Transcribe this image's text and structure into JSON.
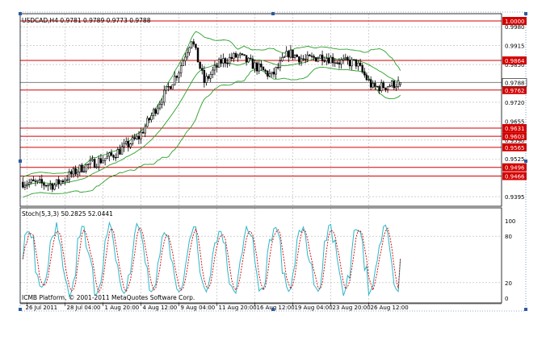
{
  "header": {
    "title": "USDCAD,H4 0.9781 0.9789 0.9773 0.9788"
  },
  "indicator": {
    "title": "Stoch(5,3,3) 50.2825 52.0441",
    "levels": [
      100,
      80,
      20,
      0
    ],
    "level_labels": [
      "100",
      "80",
      "20",
      "0"
    ]
  },
  "footer": {
    "copyright": "ICMB Platform, © 2001-2011 MetaQuotes Software Corp."
  },
  "colors": {
    "candle": "#000000",
    "bands": "#2aa02a",
    "resistance_lines": "#d40000",
    "current_price_line": "#808080",
    "stoch_main": "#2ab8c8",
    "stoch_signal": "#d40000",
    "grid": "#b4b4b4",
    "selection_handle": "#2d5aa0"
  },
  "chart_data": [
    {
      "type": "candlestick",
      "title": "USDCAD,H4 0.9781 0.9789 0.9773 0.9788",
      "symbol": "USDCAD",
      "timeframe": "H4",
      "ohlc_header": {
        "open": 0.9781,
        "high": 0.9789,
        "low": 0.9773,
        "close": 0.9788
      },
      "x_tick_labels": [
        "26 Jul 2011",
        "28 Jul 04:00",
        "1 Aug 20:00",
        "4 Aug 12:00",
        "9 Aug 04:00",
        "11 Aug 20:00",
        "16 Aug 12:00",
        "19 Aug 04:00",
        "23 Aug 20:00",
        "26 Aug 12:00"
      ],
      "y_tick_labels": [
        0.998,
        0.9915,
        0.985,
        0.972,
        0.9655,
        0.959,
        0.9525,
        0.9395
      ],
      "ylim": [
        0.9362,
        1.0025
      ],
      "current_price": 0.9788,
      "horizontal_levels": [
        1.0,
        0.9864,
        0.9762,
        0.9631,
        0.9603,
        0.9565,
        0.9496,
        0.9466
      ],
      "bollinger_bands": true,
      "grid": true,
      "candle_count": 180,
      "close_path_anchors": {
        "bar_index": [
          0,
          15,
          28,
          42,
          55,
          66,
          74,
          80,
          86,
          94,
          102,
          110,
          118,
          126,
          134,
          142,
          150,
          158,
          166,
          172,
          179
        ],
        "close": [
          0.9445,
          0.9435,
          0.9495,
          0.9535,
          0.96,
          0.9735,
          0.983,
          0.994,
          0.979,
          0.986,
          0.988,
          0.9845,
          0.981,
          0.989,
          0.9865,
          0.988,
          0.986,
          0.9855,
          0.977,
          0.9776,
          0.9788
        ]
      }
    },
    {
      "type": "line",
      "title": "Stoch(5,3,3) 50.2825 52.0441",
      "indicator": "Stochastic",
      "parameters": [
        5,
        3,
        3
      ],
      "values": {
        "main": 50.2825,
        "signal": 52.0441
      },
      "ylim": [
        0,
        100
      ],
      "y_tick_labels": [
        100,
        80,
        20,
        0
      ],
      "series": [
        {
          "key": "main",
          "oscillation_period_bars": 13
        },
        {
          "key": "signal",
          "lag_bars": 2
        }
      ]
    }
  ]
}
